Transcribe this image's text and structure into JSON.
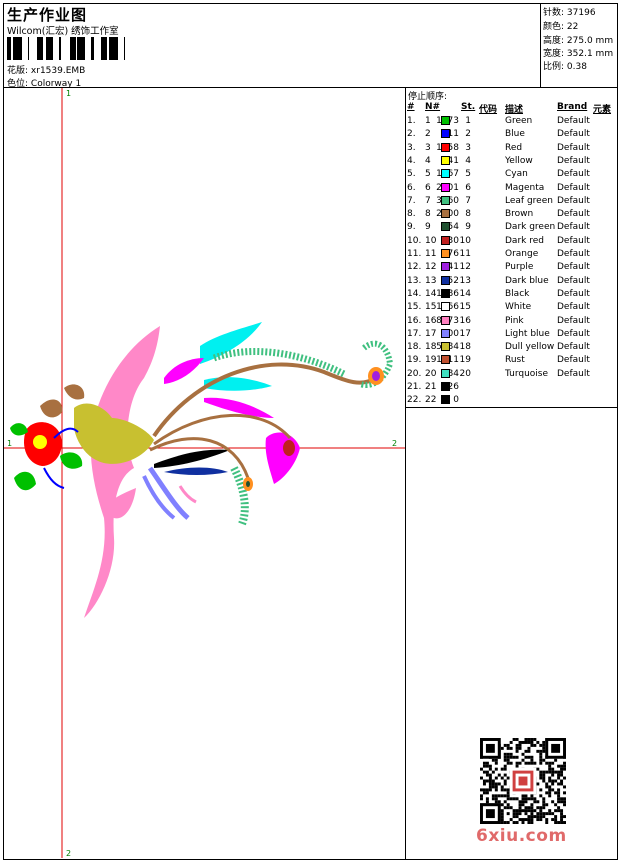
{
  "header": {
    "title": "生产作业图",
    "company": "Wilcom(汇宏) 绣饰工作室",
    "pattern_label": "花版:",
    "pattern_value": "xr1539.EMB",
    "colorway_label": "色位:",
    "colorway_value": "Colorway 1"
  },
  "stats": [
    {
      "label": "针数:",
      "value": "37196"
    },
    {
      "label": "颜色:",
      "value": "22"
    },
    {
      "label": "高度:",
      "value": "275.0 mm"
    },
    {
      "label": "宽度:",
      "value": "352.1 mm"
    },
    {
      "label": "比例:",
      "value": "0.38"
    }
  ],
  "axes": {
    "top_marker": "1",
    "bottom_marker": "2",
    "left_marker": "1",
    "right_marker": "2"
  },
  "stop_sequence_title": "停止顺序:",
  "columns": [
    "#",
    "N#",
    "St.",
    "代码",
    "描述",
    "Brand",
    "元素"
  ],
  "threads": [
    {
      "n": "1.",
      "num": "1",
      "color": "#00c000",
      "st": "1673",
      "code": "1",
      "desc": "Green",
      "brand": "Default"
    },
    {
      "n": "2.",
      "num": "2",
      "color": "#0000ff",
      "st": "811",
      "code": "2",
      "desc": "Blue",
      "brand": "Default"
    },
    {
      "n": "3.",
      "num": "3",
      "color": "#ff0000",
      "st": "1758",
      "code": "3",
      "desc": "Red",
      "brand": "Default"
    },
    {
      "n": "4.",
      "num": "4",
      "color": "#ffff00",
      "st": "341",
      "code": "4",
      "desc": "Yellow",
      "brand": "Default"
    },
    {
      "n": "5.",
      "num": "5",
      "color": "#00ffff",
      "st": "1967",
      "code": "5",
      "desc": "Cyan",
      "brand": "Default"
    },
    {
      "n": "6.",
      "num": "6",
      "color": "#ff00ff",
      "st": "2401",
      "code": "6",
      "desc": "Magenta",
      "brand": "Default"
    },
    {
      "n": "7.",
      "num": "7",
      "color": "#40c080",
      "st": "3960",
      "code": "7",
      "desc": "Leaf green",
      "brand": "Default"
    },
    {
      "n": "8.",
      "num": "8",
      "color": "#a87040",
      "st": "2500",
      "code": "8",
      "desc": "Brown",
      "brand": "Default"
    },
    {
      "n": "9.",
      "num": "9",
      "color": "#205030",
      "st": "254",
      "code": "9",
      "desc": "Dark green",
      "brand": "Default"
    },
    {
      "n": "10.",
      "num": "10",
      "color": "#c02020",
      "st": "130",
      "code": "10",
      "desc": "Dark red",
      "brand": "Default"
    },
    {
      "n": "11.",
      "num": "11",
      "color": "#ff9020",
      "st": "476",
      "code": "11",
      "desc": "Orange",
      "brand": "Default"
    },
    {
      "n": "12.",
      "num": "12",
      "color": "#a020e0",
      "st": "141",
      "code": "12",
      "desc": "Purple",
      "brand": "Default"
    },
    {
      "n": "13.",
      "num": "13",
      "color": "#1030a0",
      "st": "552",
      "code": "13",
      "desc": "Dark blue",
      "brand": "Default"
    },
    {
      "n": "14.",
      "num": "14",
      "color": "#000000",
      "st": "1486",
      "code": "14",
      "desc": "Black",
      "brand": "Default"
    },
    {
      "n": "15.",
      "num": "15",
      "color": "#ffffff",
      "st": "1866",
      "code": "15",
      "desc": "White",
      "brand": "Default"
    },
    {
      "n": "16.",
      "num": "16",
      "color": "#ff80c0",
      "st": "8373",
      "code": "16",
      "desc": "Pink",
      "brand": "Default"
    },
    {
      "n": "17.",
      "num": "17",
      "color": "#8080ff",
      "st": "900",
      "code": "17",
      "desc": "Light blue",
      "brand": "Default"
    },
    {
      "n": "18.",
      "num": "18",
      "color": "#c8c030",
      "st": "5884",
      "code": "18",
      "desc": "Dull yellow",
      "brand": "Default"
    },
    {
      "n": "19.",
      "num": "19",
      "color": "#c05030",
      "st": "1311",
      "code": "19",
      "desc": "Rust",
      "brand": "Default"
    },
    {
      "n": "20.",
      "num": "20",
      "color": "#40e0c0",
      "st": "284",
      "code": "20",
      "desc": "Turquoise",
      "brand": "Default"
    },
    {
      "n": "21.",
      "num": "21",
      "color": "#000000",
      "st": "126",
      "code": "",
      "desc": "",
      "brand": ""
    },
    {
      "n": "22.",
      "num": "22",
      "color": "#000000",
      "st": "0",
      "code": "",
      "desc": "",
      "brand": ""
    }
  ],
  "watermark": "6xiu.com"
}
